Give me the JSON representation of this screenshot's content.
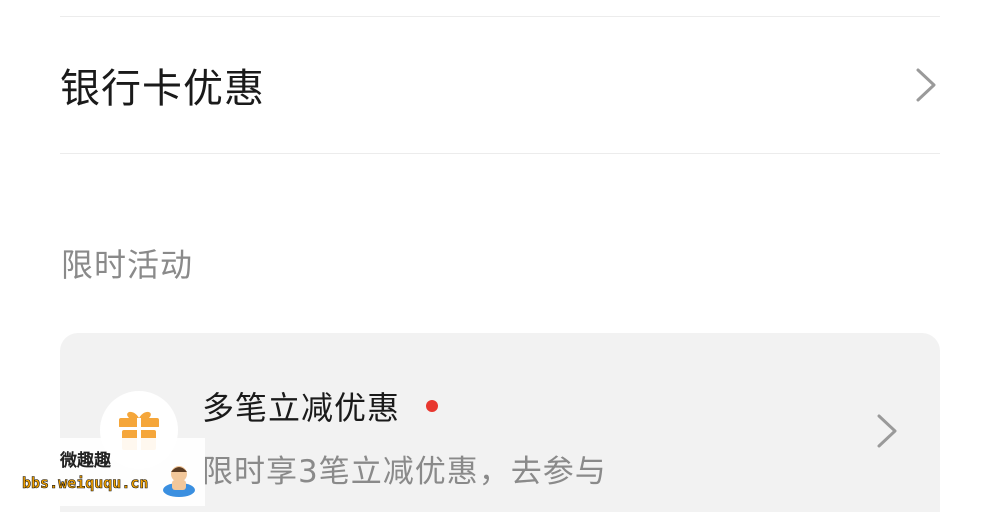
{
  "bank_offers": {
    "label": "银行卡优惠",
    "chevron_icon": "chevron-right-icon"
  },
  "limited_activity": {
    "section_title": "限时活动",
    "card": {
      "icon": "gift-icon",
      "title": "多笔立减优惠",
      "subtitle": "限时享3笔立减优惠，去参与",
      "indicator_color": "#e8372f",
      "chevron_icon": "chevron-right-icon"
    }
  },
  "watermark": {
    "name": "微趣趣",
    "url": "bbs.weiququ.cn"
  },
  "colors": {
    "gift": "#f5a63a",
    "card_bg": "#f2f2f2",
    "muted_text": "#8a8a8a",
    "divider": "#ececec"
  }
}
